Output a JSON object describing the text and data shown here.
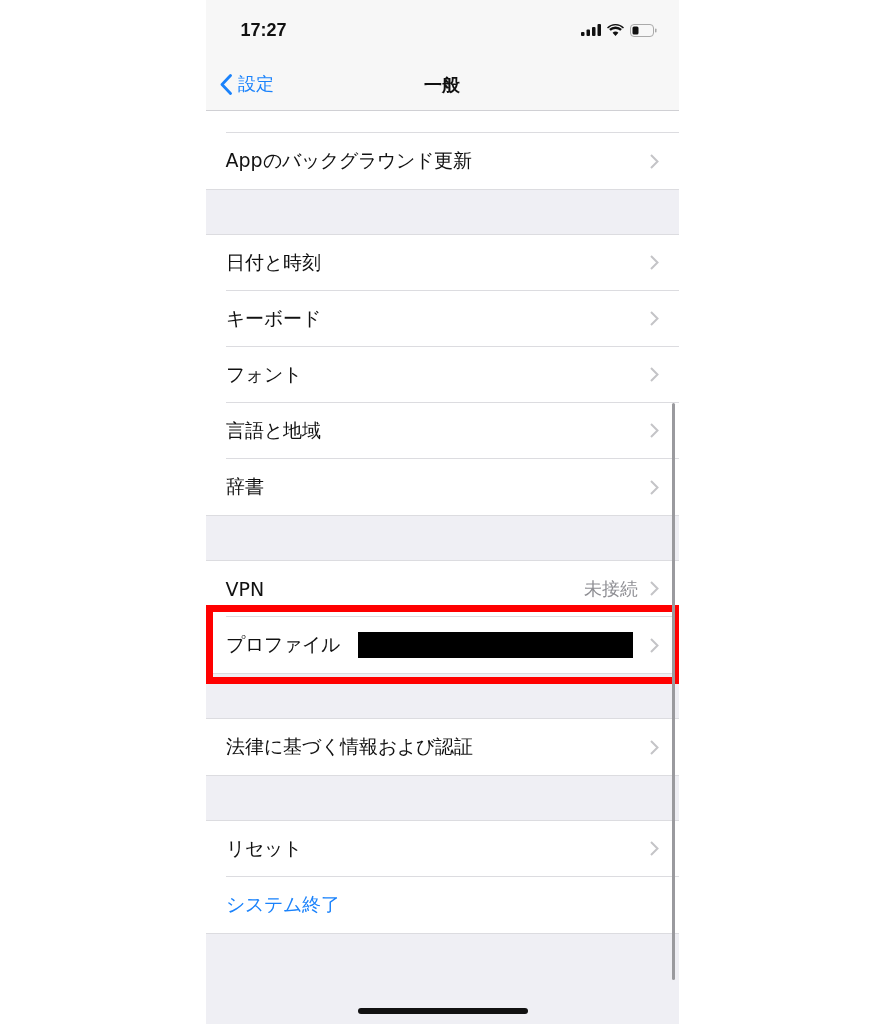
{
  "status_bar": {
    "time": "17:27"
  },
  "nav_bar": {
    "back": "設定",
    "title": "一般"
  },
  "sections": [
    {
      "clipped_top": true,
      "rows": [
        {
          "kind": "link",
          "label": "Appのバックグラウンド更新"
        }
      ]
    },
    {
      "rows": [
        {
          "kind": "link",
          "label": "日付と時刻"
        },
        {
          "kind": "link",
          "label": "キーボード"
        },
        {
          "kind": "link",
          "label": "フォント"
        },
        {
          "kind": "link",
          "label": "言語と地域"
        },
        {
          "kind": "link",
          "label": "辞書"
        }
      ]
    },
    {
      "rows": [
        {
          "kind": "link",
          "label": "VPN",
          "detail": "未接続"
        },
        {
          "kind": "link",
          "label": "プロファイル",
          "redacted": true,
          "highlighted": true
        }
      ]
    },
    {
      "rows": [
        {
          "kind": "link",
          "label": "法律に基づく情報および認証"
        }
      ]
    },
    {
      "rows": [
        {
          "kind": "link",
          "label": "リセット"
        },
        {
          "kind": "action",
          "label": "システム終了"
        }
      ]
    }
  ]
}
